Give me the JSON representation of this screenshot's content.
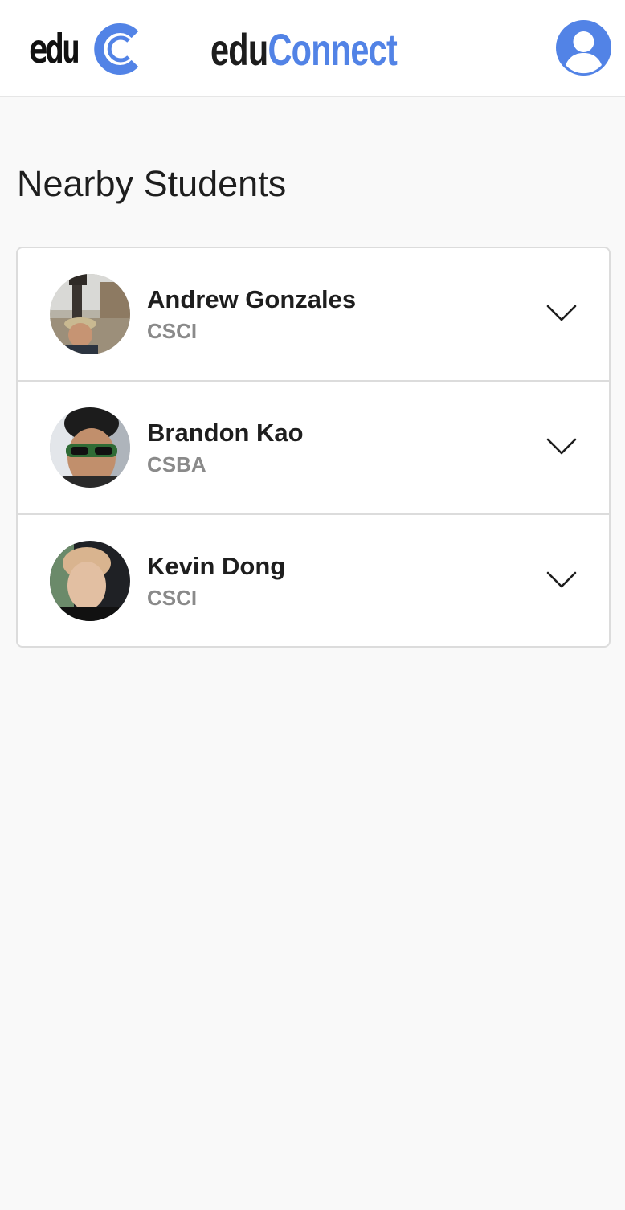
{
  "header": {
    "logo_text": "edu",
    "brand_part1": "edu",
    "brand_part2": "Connect"
  },
  "page_title": "Nearby Students",
  "students": [
    {
      "name": "Andrew Gonzales",
      "major": "CSCI"
    },
    {
      "name": "Brandon Kao",
      "major": "CSBA"
    },
    {
      "name": "Kevin Dong",
      "major": "CSCI"
    }
  ],
  "icons": {
    "profile": "user-circle-icon",
    "expand": "chevron-down-icon"
  },
  "colors": {
    "brand_blue": "#5283e6",
    "text_dark": "#1e1e1e",
    "text_muted": "#8a8a8a",
    "background": "#f9f9f9"
  }
}
